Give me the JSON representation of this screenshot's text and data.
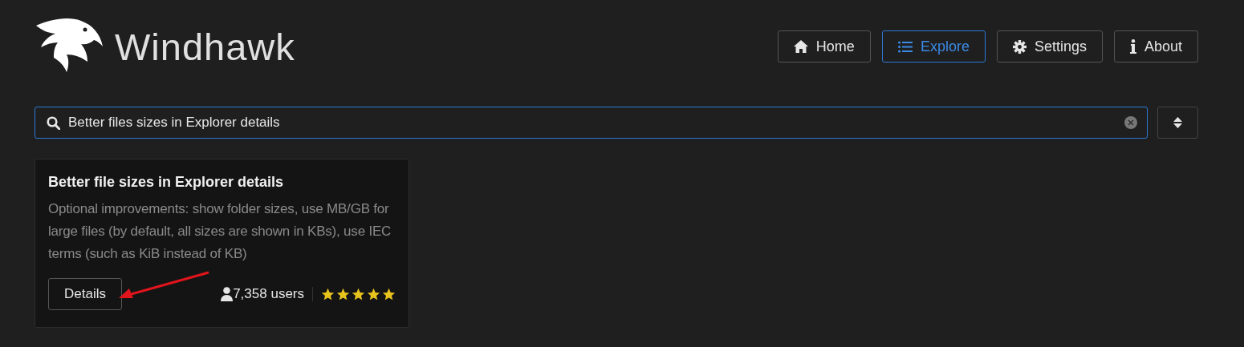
{
  "app": {
    "name": "Windhawk"
  },
  "nav": [
    {
      "label": "Home",
      "kind": "home",
      "selected": false
    },
    {
      "label": "Explore",
      "kind": "explore",
      "selected": true
    },
    {
      "label": "Settings",
      "kind": "settings",
      "selected": false
    },
    {
      "label": "About",
      "kind": "about",
      "selected": false
    }
  ],
  "search": {
    "value": "Better files sizes in Explorer details"
  },
  "mods": [
    {
      "title": "Better file sizes in Explorer details",
      "description": "Optional improvements: show folder sizes, use MB/GB for large files (by default, all sizes are shown in KBs), use IEC terms (such as KiB instead of KB)",
      "button": "Details",
      "users": "7,358 users",
      "stars": 5
    }
  ]
}
